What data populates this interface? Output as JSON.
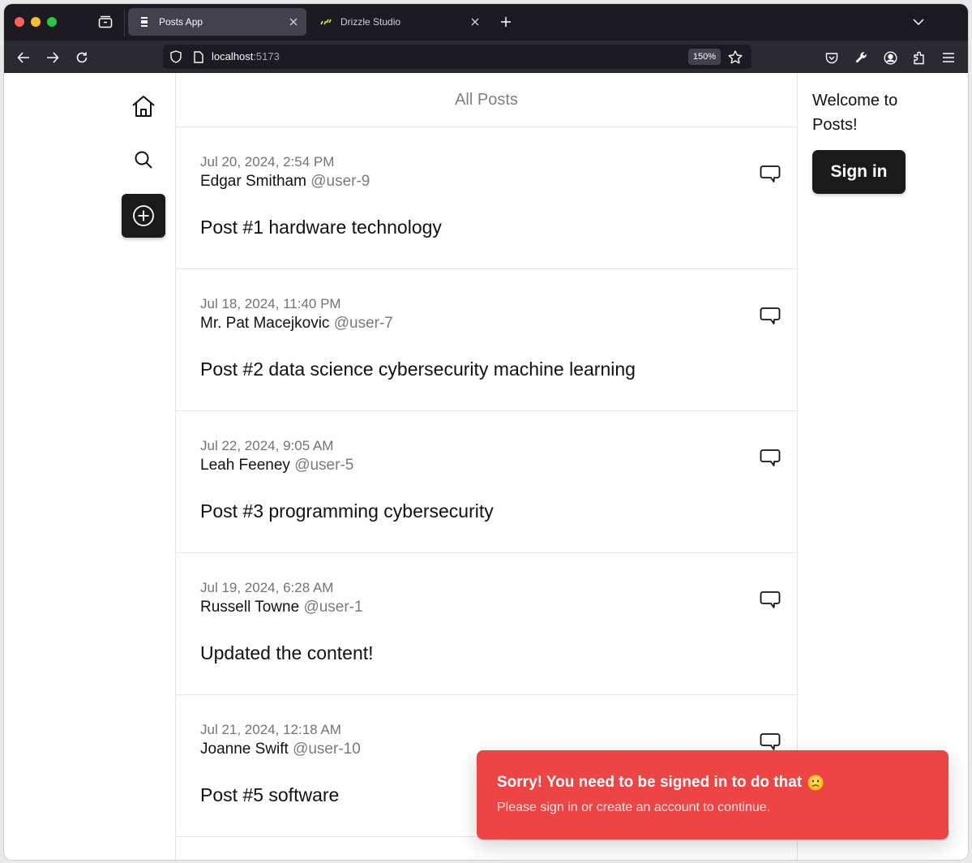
{
  "browser": {
    "tabs": [
      {
        "title": "Posts App",
        "active": true,
        "icon": "page-icon"
      },
      {
        "title": "Drizzle Studio",
        "active": false,
        "icon": "drizzle-icon"
      }
    ],
    "url": {
      "host": "localhost",
      "port": ":5173"
    },
    "zoom": "150%"
  },
  "leftnav": {
    "items": [
      {
        "name": "home",
        "icon": "home-icon"
      },
      {
        "name": "search",
        "icon": "search-icon"
      },
      {
        "name": "new-post",
        "icon": "plus-circle-icon"
      }
    ]
  },
  "feed": {
    "title": "All Posts",
    "posts": [
      {
        "date": "Jul 20, 2024, 2:54 PM",
        "author": "Edgar Smitham",
        "handle": "@user-9",
        "content": "Post #1 hardware technology"
      },
      {
        "date": "Jul 18, 2024, 11:40 PM",
        "author": "Mr. Pat Macejkovic",
        "handle": "@user-7",
        "content": "Post #2 data science cybersecurity machine learning"
      },
      {
        "date": "Jul 22, 2024, 9:05 AM",
        "author": "Leah Feeney",
        "handle": "@user-5",
        "content": "Post #3 programming cybersecurity"
      },
      {
        "date": "Jul 19, 2024, 6:28 AM",
        "author": "Russell Towne",
        "handle": "@user-1",
        "content": "Updated the content!"
      },
      {
        "date": "Jul 21, 2024, 12:18 AM",
        "author": "Joanne Swift",
        "handle": "@user-10",
        "content": "Post #5 software"
      }
    ]
  },
  "sidebar": {
    "welcome": "Welcome to Posts!",
    "signin_label": "Sign in"
  },
  "toast": {
    "title": "Sorry! You need to be signed in to do that",
    "emoji": "slightly-frowning-face",
    "description": "Please sign in or create an account to continue.",
    "color": "#ef4444"
  }
}
